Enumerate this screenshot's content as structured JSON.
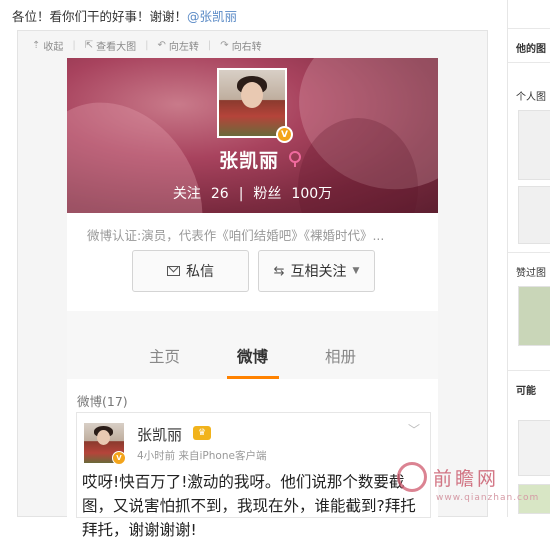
{
  "post": {
    "text": "各位！看你们干的好事！谢谢！",
    "mention": "@张凯丽"
  },
  "toolbar": {
    "collapse": "收起",
    "view_large": "查看大图",
    "rotate_left": "向左转",
    "rotate_right": "向右转"
  },
  "profile": {
    "name": "张凯丽",
    "following_label": "关注",
    "following_count": "26",
    "divider": "|",
    "followers_label": "粉丝",
    "followers_count": "100万",
    "verification": "微博认证:演员，代表作《咱们结婚吧》《裸婚时代》..."
  },
  "buttons": {
    "message": "私信",
    "mutual_follow": "互相关注"
  },
  "tabs": [
    {
      "label": "主页",
      "active": false
    },
    {
      "label": "微博",
      "active": true
    },
    {
      "label": "相册",
      "active": false
    }
  ],
  "weibo_section": {
    "count_label": "微博(17)"
  },
  "feed": {
    "author": "张凯丽",
    "meta": "4小时前  来自iPhone客户端",
    "text": "哎呀!快百万了!激动的我呀。他们说那个数要截图，又说害怕抓不到，我现在外，谁能截到?拜托拜托，谢谢谢谢!"
  },
  "right_column": {
    "label_1": "他的图",
    "label_2": "个人图",
    "label_3": "赞过图",
    "label_4": "可能"
  },
  "watermark": {
    "text": "前瞻网",
    "url": "www.qianzhan.com"
  },
  "colors": {
    "accent": "#ff8200",
    "link": "#5a8ac6",
    "verified": "#f3a41b"
  }
}
